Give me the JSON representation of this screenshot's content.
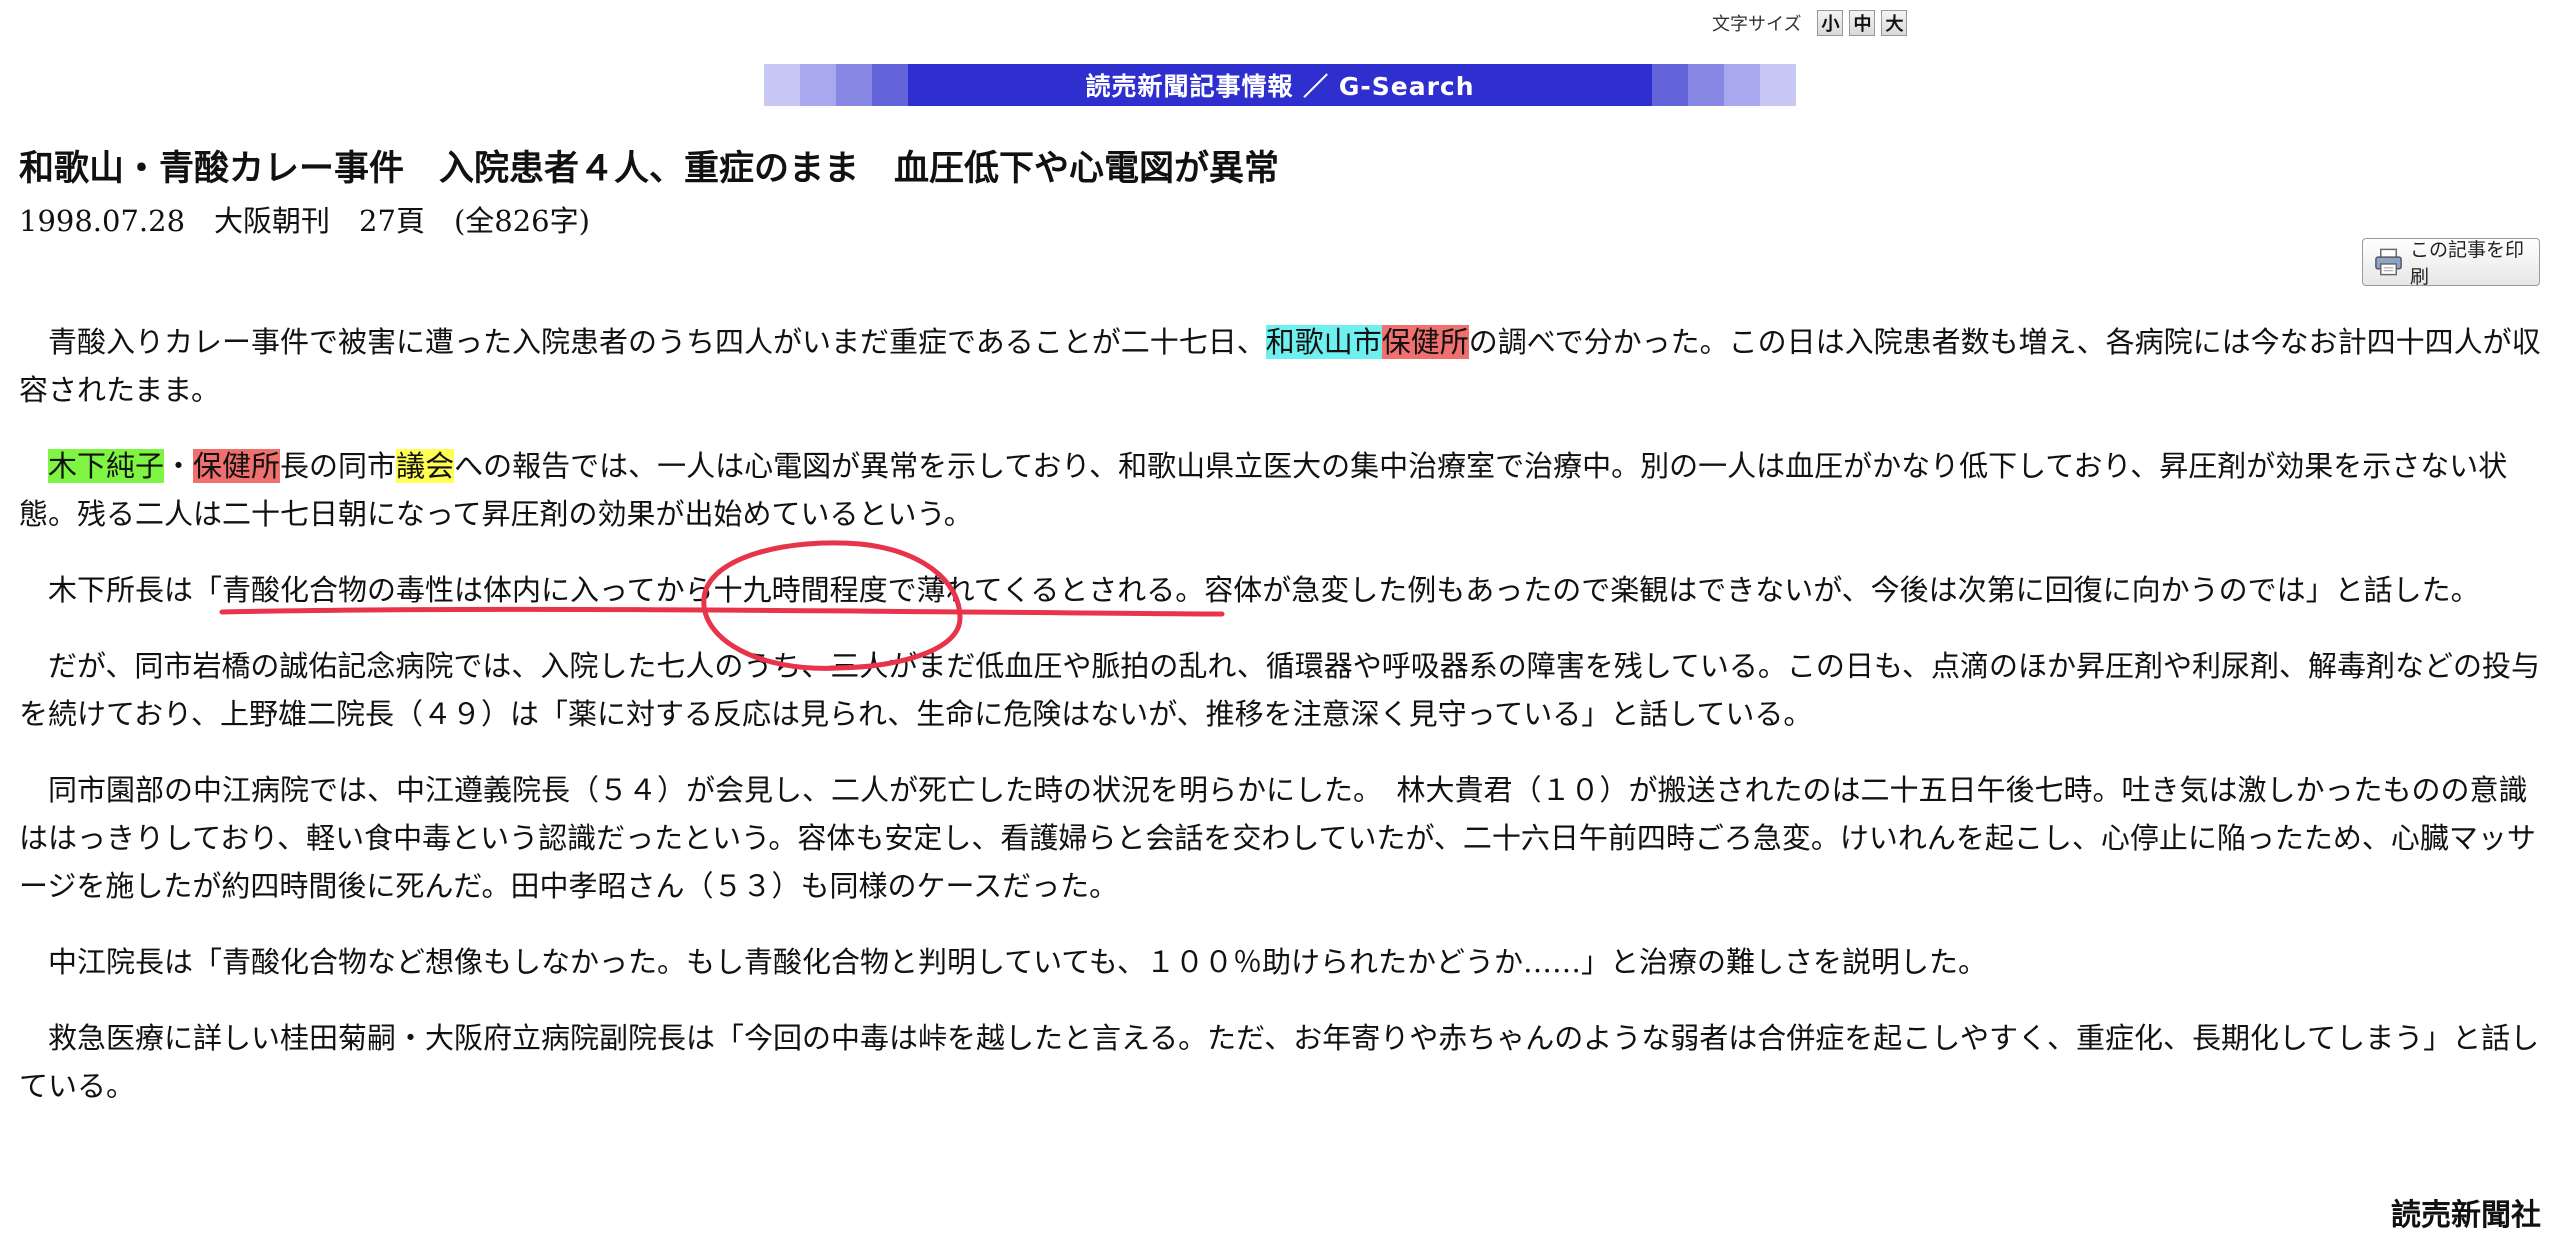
{
  "font_size": {
    "label": "文字サイズ",
    "small": "小",
    "medium": "中",
    "large": "大"
  },
  "banner": {
    "text": "読売新聞記事情報 ／ G-Search",
    "color": "#2f2fcf"
  },
  "article": {
    "title": "和歌山・青酸カレー事件　入院患者４人、重症のまま　血圧低下や心電図が異常",
    "meta": "1998.07.28　大阪朝刊　27頁　(全826字)",
    "print_label": "この記事を印刷",
    "paragraphs": [
      {
        "pre": "青酸入りカレー事件で被害に遭った入院患者のうち四人がいまだ重症であることが二十七日、",
        "hl1": "和歌山市",
        "hl2": "保健所",
        "post": "の調べで分かった。この日は入院患者数も増え、各病院には今なお計四十四人が収容されたまま。"
      },
      {
        "hl1": "木下純子",
        "mid1": "・",
        "hl2": "保健所",
        "mid2": "長の同市",
        "hl3": "議会",
        "post": "への報告では、一人は心電図が異常を示しており、和歌山県立医大の集中治療室で治療中。別の一人は血圧がかなり低下しており、昇圧剤が効果を示さない状態。残る二人は二十七日朝になって昇圧剤の効果が出始めているという。"
      },
      {
        "pre": "木下所長は",
        "underlined": "「青酸化合物の毒性は体内に入ってから十九時間程度で薄れてくるとされる。",
        "post": "容体が急変した例もあったので楽観はできないが、今後は次第に回復に向かうのでは」と話した。"
      },
      {
        "text": "だが、同市岩橋の誠佑記念病院では、入院した七人のうち、三人がまだ低血圧や脈拍の乱れ、循環器や呼吸器系の障害を残している。この日も、点滴のほか昇圧剤や利尿剤、解毒剤などの投与を続けており、上野雄二院長（４９）は「薬に対する反応は見られ、生命に危険はないが、推移を注意深く見守っている」と話している。"
      },
      {
        "text": "同市園部の中江病院では、中江遵義院長（５４）が会見し、二人が死亡した時の状況を明らかにした。　林大貴君（１０）が搬送されたのは二十五日午後七時。吐き気は激しかったものの意識ははっきりしており、軽い食中毒という認識だったという。容体も安定し、看護婦らと会話を交わしていたが、二十六日午前四時ごろ急変。けいれんを起こし、心停止に陥ったため、心臓マッサージを施したが約四時間後に死んだ。田中孝昭さん（５３）も同様のケースだった。"
      },
      {
        "text": "中江院長は「青酸化合物など想像もしなかった。もし青酸化合物と判明していても、１００％助けられたかどうか……」と治療の難しさを説明した。"
      },
      {
        "text": "救急医療に詳しい桂田菊嗣・大阪府立病院副院長は「今回の中毒は峠を越したと言える。ただ、お年寄りや赤ちゃんのような弱者は合併症を起こしやすく、重症化、長期化してしまう」と話している。"
      }
    ],
    "byline": "読売新聞社"
  },
  "colors": {
    "highlight_cyan": "#6ff0f0",
    "highlight_red": "#f07070",
    "highlight_green": "#7df542",
    "highlight_yellow": "#ffff55",
    "annotation_red": "#e8344a"
  }
}
